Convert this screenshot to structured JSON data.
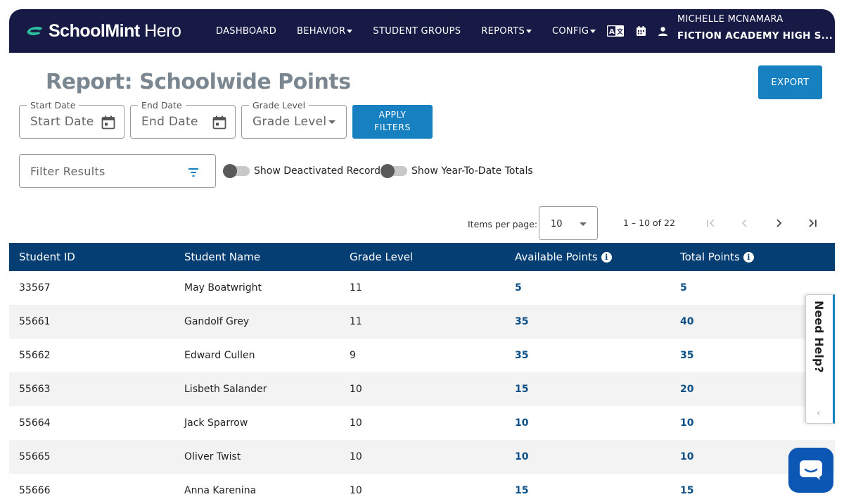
{
  "header": {
    "logo_bold": "SchoolMint",
    "logo_light": " Hero",
    "nav": [
      {
        "label": "DASHBOARD",
        "dropdown": false
      },
      {
        "label": "BEHAVIOR",
        "dropdown": true
      },
      {
        "label": "STUDENT GROUPS",
        "dropdown": false
      },
      {
        "label": "REPORTS",
        "dropdown": true
      },
      {
        "label": "CONFIG",
        "dropdown": true
      }
    ],
    "user_name": "MICHELLE MCNAMARA",
    "school_name": "FICTION ACADEMY HIGH S..."
  },
  "page": {
    "title": "Report: Schoolwide Points",
    "export_label": "EXPORT"
  },
  "filters": {
    "start_date": {
      "label": "Start Date",
      "placeholder": "Start Date"
    },
    "end_date": {
      "label": "End Date",
      "placeholder": "End Date"
    },
    "grade_level": {
      "label": "Grade Level",
      "placeholder": "Grade Level"
    },
    "apply_label_1": "APPLY",
    "apply_label_2": "FILTERS",
    "filter_results_placeholder": "Filter Results",
    "toggle_deactivated": "Show Deactivated Records",
    "toggle_ytd": "Show Year-To-Date Totals"
  },
  "paginator": {
    "items_per_page_label": "Items per page:",
    "items_per_page": "10",
    "range": "1 – 10 of 22"
  },
  "table": {
    "columns": [
      "Student ID",
      "Student Name",
      "Grade Level",
      "Available Points",
      "Total Points"
    ],
    "rows": [
      {
        "id": "33567",
        "name": "May Boatwright",
        "grade": "11",
        "available": "5",
        "total": "5"
      },
      {
        "id": "55661",
        "name": "Gandolf Grey",
        "grade": "11",
        "available": "35",
        "total": "40"
      },
      {
        "id": "55662",
        "name": "Edward Cullen",
        "grade": "9",
        "available": "35",
        "total": "35"
      },
      {
        "id": "55663",
        "name": "Lisbeth Salander",
        "grade": "10",
        "available": "15",
        "total": "20"
      },
      {
        "id": "55664",
        "name": "Jack Sparrow",
        "grade": "10",
        "available": "10",
        "total": "10"
      },
      {
        "id": "55665",
        "name": "Oliver Twist",
        "grade": "10",
        "available": "10",
        "total": "10"
      },
      {
        "id": "55666",
        "name": "Anna Karenina",
        "grade": "10",
        "available": "15",
        "total": "15"
      }
    ]
  },
  "help": {
    "label": "Need Help?"
  },
  "colors": {
    "nav_bg": "#171a45",
    "primary_button": "#1680c0",
    "table_header": "#043e72",
    "points_text": "#0b4f86",
    "chat_button": "#0c57b4"
  }
}
